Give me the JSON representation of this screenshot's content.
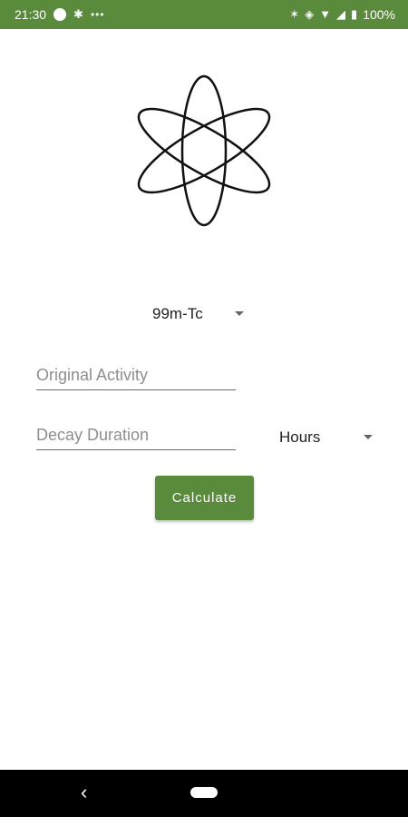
{
  "status_bar": {
    "time": "21:30",
    "battery": "100%",
    "background_color": "#5a8a3c"
  },
  "logo": {
    "icon": "atom-icon"
  },
  "isotope": {
    "selected": "99m-Tc"
  },
  "original_activity": {
    "placeholder": "Original Activity",
    "value": ""
  },
  "decay_duration": {
    "placeholder": "Decay Duration",
    "value": ""
  },
  "units": {
    "selected": "Hours"
  },
  "calculate_button": {
    "label": "Calculate",
    "color": "#5a8a3c"
  }
}
